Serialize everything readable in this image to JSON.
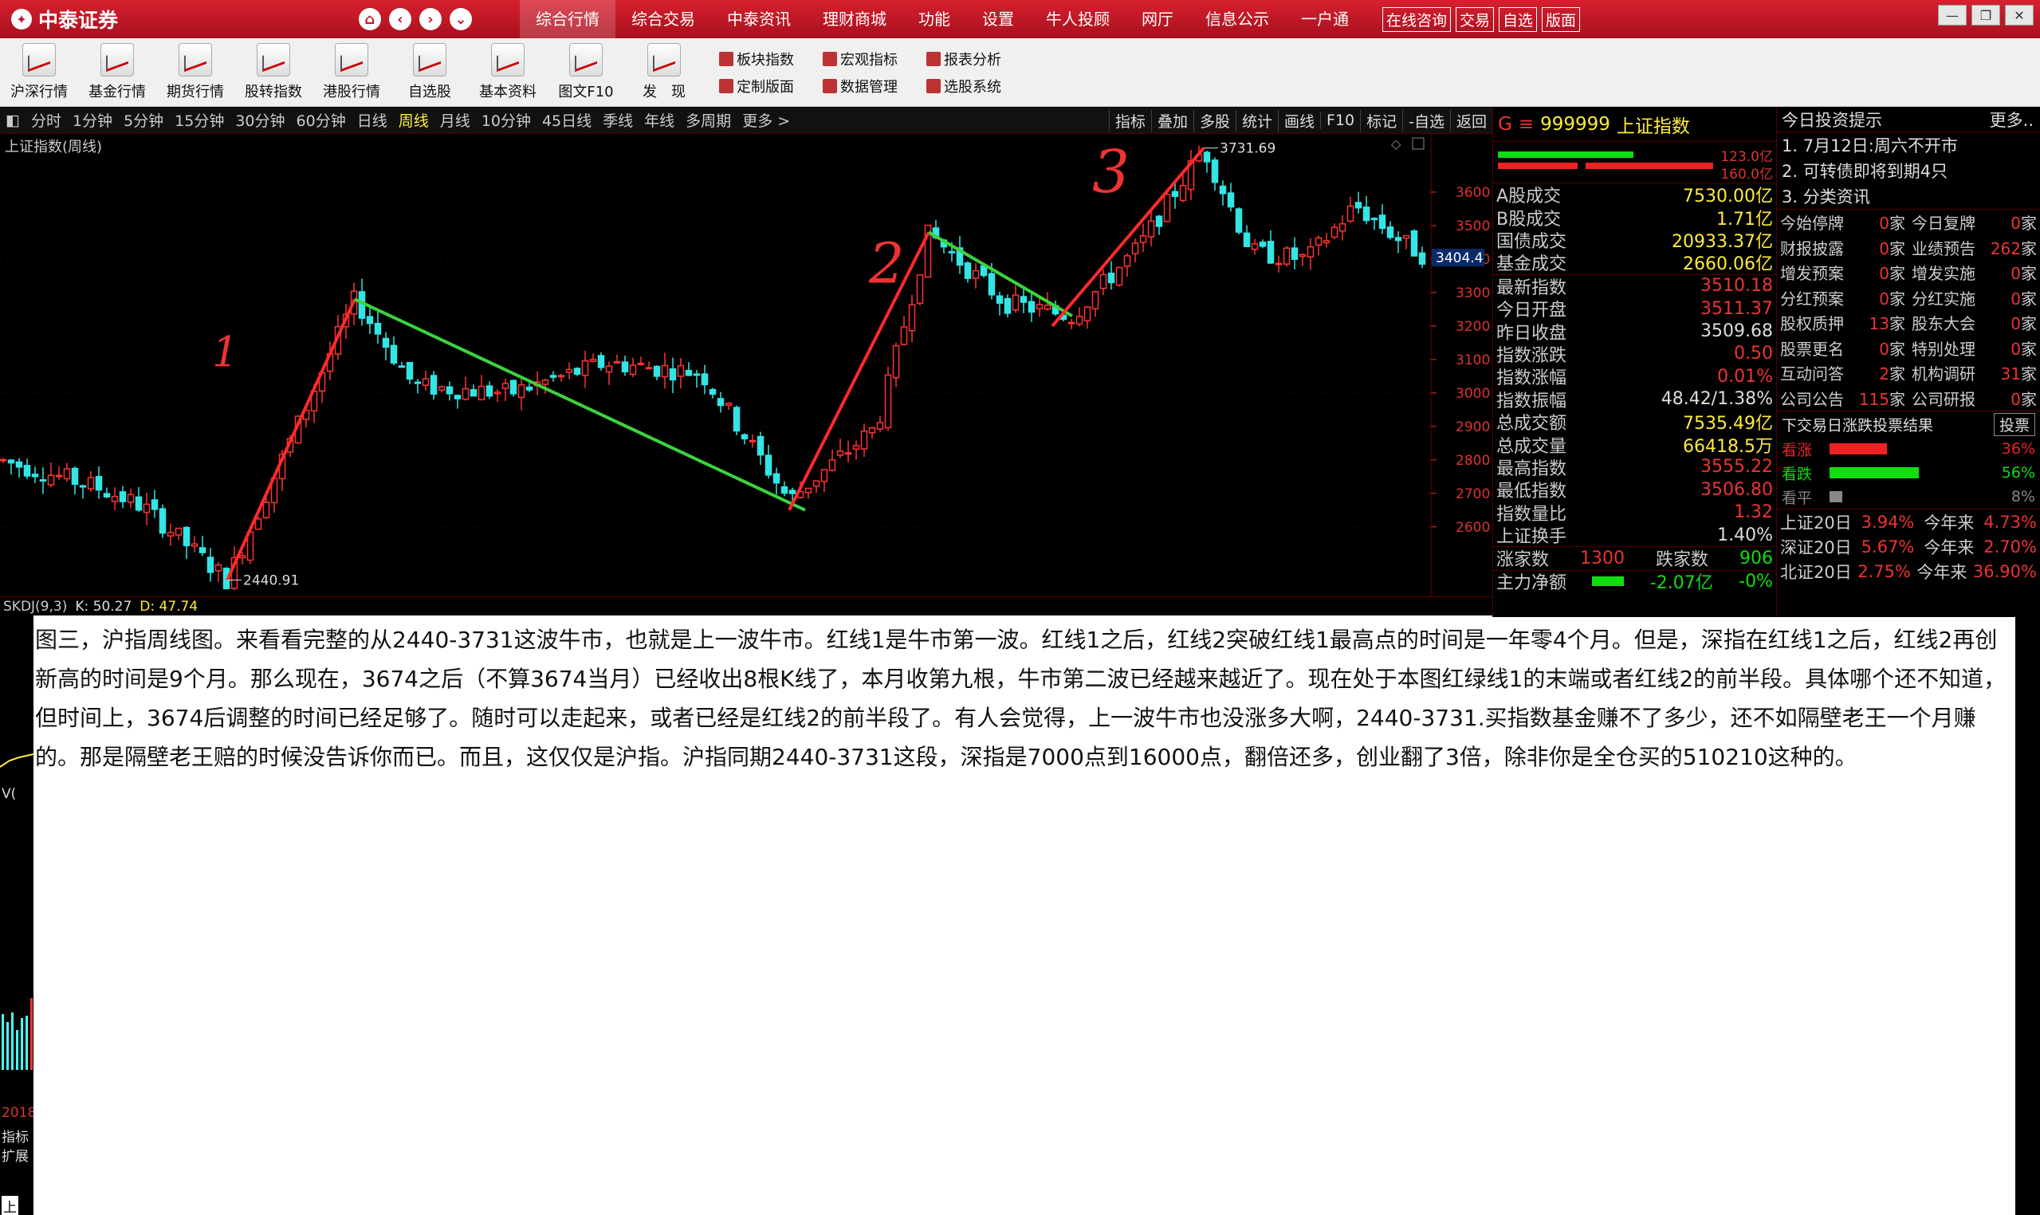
{
  "titlebar": {
    "brand": "中泰证券",
    "menu": [
      "综合行情",
      "综合交易",
      "中泰资讯",
      "理财商城",
      "功能",
      "设置",
      "牛人投顾",
      "网厅",
      "信息公示",
      "一户通"
    ],
    "boxed": [
      "在线咨询",
      "交易",
      "自选",
      "版面"
    ]
  },
  "toolbar": {
    "big": [
      "沪深行情",
      "基金行情",
      "期货行情",
      "股转指数",
      "港股行情",
      "自选股",
      "基本资料",
      "图文F10",
      "发　现"
    ],
    "small": [
      "板块指数",
      "宏观指标",
      "报表分析",
      "定制版面",
      "数据管理",
      "选股系统"
    ]
  },
  "periods": [
    "分时",
    "1分钟",
    "5分钟",
    "15分钟",
    "30分钟",
    "60分钟",
    "日线",
    "周线",
    "月线",
    "10分钟",
    "45日线",
    "季线",
    "年线",
    "多周期",
    "更多 >"
  ],
  "period_tools": [
    "指标",
    "叠加",
    "多股",
    "统计",
    "画线",
    "F10",
    "标记",
    "-自选",
    "返回"
  ],
  "chart": {
    "title": "上证指数(周线)",
    "high_label": "3731.69",
    "low_label": "2440.91",
    "current_price": "3404.4",
    "axis": [
      "3600",
      "3500",
      "3400",
      "3300",
      "3200",
      "3100",
      "3000",
      "2900",
      "2800",
      "2700",
      "2600"
    ],
    "annotations": [
      "1",
      "2",
      "3"
    ]
  },
  "chart_data": {
    "type": "candlestick",
    "title": "上证指数(周线)",
    "high": 3731.69,
    "low": 2440.91,
    "last": 3404.4,
    "ylim": [
      2440,
      3750
    ],
    "y_ticks": [
      2600,
      2700,
      2800,
      2900,
      3000,
      3100,
      3200,
      3300,
      3400,
      3500,
      3600
    ],
    "trend_lines": [
      {
        "color": "red",
        "from": 2440.91,
        "to": 3280
      },
      {
        "color": "green",
        "from": 3280,
        "to": 2650
      },
      {
        "color": "red",
        "from": 2650,
        "to": 3480
      },
      {
        "color": "green",
        "from": 3480,
        "to": 3230
      },
      {
        "color": "red",
        "from": 3230,
        "to": 3731.69
      }
    ]
  },
  "indicator": {
    "name": "SKDJ(9,3)",
    "k": "K: 50.27",
    "d": "D: 47.74"
  },
  "lower_labels": [
    "V(",
    "2018",
    "指标",
    "扩展",
    "上"
  ],
  "info": {
    "code": "999999",
    "name": "上证指数",
    "bar1": "123.0亿",
    "bar2": "160.0亿",
    "rows1": [
      [
        "A股成交",
        "7530.00亿"
      ],
      [
        "B股成交",
        "1.71亿"
      ],
      [
        "国债成交",
        "20933.37亿"
      ],
      [
        "基金成交",
        "2660.06亿"
      ]
    ],
    "rows2": [
      [
        "最新指数",
        "3510.18"
      ],
      [
        "今日开盘",
        "3511.37"
      ],
      [
        "昨日收盘",
        "3509.68"
      ],
      [
        "指数涨跌",
        "0.50"
      ],
      [
        "指数涨幅",
        "0.01%"
      ],
      [
        "指数振幅",
        "48.42/1.38%"
      ],
      [
        "总成交额",
        "7535.49亿"
      ],
      [
        "总成交量",
        "66418.5万"
      ],
      [
        "最高指数",
        "3555.22"
      ],
      [
        "最低指数",
        "3506.80"
      ],
      [
        "指数量比",
        "1.32"
      ],
      [
        "上证换手",
        "1.40%"
      ]
    ],
    "up_label": "涨家数",
    "up": "1300",
    "down_label": "跌家数",
    "down": "906",
    "flow_label": "主力净额",
    "flow": "-2.07亿",
    "flow_pct": "-0%"
  },
  "tips": {
    "title": "今日投资提示",
    "more": "更多..",
    "items": [
      "1. 7月12日:周六不开市",
      "2. 可转债即将到期4只",
      "3. 分类资讯"
    ],
    "grid": [
      [
        "今始停牌",
        "0",
        "今日复牌",
        "0"
      ],
      [
        "财报披露",
        "0",
        "业绩预告",
        "262"
      ],
      [
        "增发预案",
        "0",
        "增发实施",
        "0"
      ],
      [
        "分红预案",
        "0",
        "分红实施",
        "0"
      ],
      [
        "股权质押",
        "13",
        "股东大会",
        "0"
      ],
      [
        "股票更名",
        "0",
        "特别处理",
        "0"
      ],
      [
        "互动问答",
        "2",
        "机构调研",
        "31"
      ],
      [
        "公司公告",
        "115",
        "公司研报",
        "0"
      ]
    ],
    "unit": "家",
    "vote_title": "下交易日涨跌投票结果",
    "vote_btn": "投票",
    "votes": [
      [
        "看涨",
        "36%"
      ],
      [
        "看跌",
        "56%"
      ],
      [
        "看平",
        "8%"
      ]
    ],
    "returns": [
      [
        "上证20日",
        "3.94%",
        "今年来",
        "4.73%"
      ],
      [
        "深证20日",
        "5.67%",
        "今年来",
        "2.70%"
      ],
      [
        "北证20日",
        "2.75%",
        "今年来",
        "36.90%"
      ]
    ]
  },
  "doc": {
    "text": "图三，沪指周线图。来看看完整的从2440-3731这波牛市，也就是上一波牛市。红线1是牛市第一波。红线1之后，红线2突破红线1最高点的时间是一年零4个月。但是，深指在红线1之后，红线2再创新高的时间是9个月。那么现在，3674之后（不算3674当月）已经收出8根K线了，本月收第九根，牛市第二波已经越来越近了。现在处于本图红绿线1的末端或者红线2的前半段。具体哪个还不知道，但时间上，3674后调整的时间已经足够了。随时可以走起来，或者已经是红线2的前半段了。有人会觉得，上一波牛市也没涨多大啊，2440-3731.买指数基金赚不了多少，还不如隔壁老王一个月赚的。那是隔壁老王赔的时候没告诉你而已。而且，这仅仅是沪指。沪指同期2440-3731这段，深指是7000点到16000点，翻倍还多，创业翻了3倍，除非你是全仓买的510210这种的。"
  }
}
